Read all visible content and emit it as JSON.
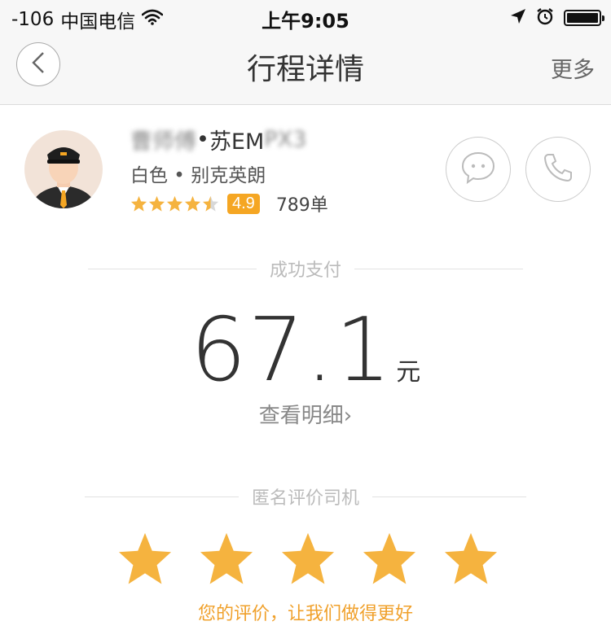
{
  "status_bar": {
    "signal": "-106",
    "carrier": "中国电信",
    "time": "上午9:05",
    "icons": [
      "wifi-icon",
      "location-arrow-icon",
      "alarm-icon",
      "battery-icon"
    ]
  },
  "nav": {
    "title": "行程详情",
    "more": "更多",
    "back_icon": "chevron-left-icon"
  },
  "driver": {
    "name_blurred": "曹师傅",
    "separator": " • ",
    "plate": "苏EM",
    "plate_blurred": "PX3",
    "car": "白色 • 别克英朗",
    "rating": "4.9",
    "orders": "789单",
    "stars": 4.5
  },
  "payment": {
    "status": "成功支付",
    "amount": "67.1",
    "currency": "元",
    "detail_link": "查看明细",
    "detail_arrow": "›"
  },
  "review": {
    "label": "匿名评价司机",
    "stars": 5,
    "hint": "您的评价，让我们做得更好"
  },
  "colors": {
    "accent": "#f5a623",
    "star": "#f5b33f",
    "hint": "#f0a02a"
  }
}
